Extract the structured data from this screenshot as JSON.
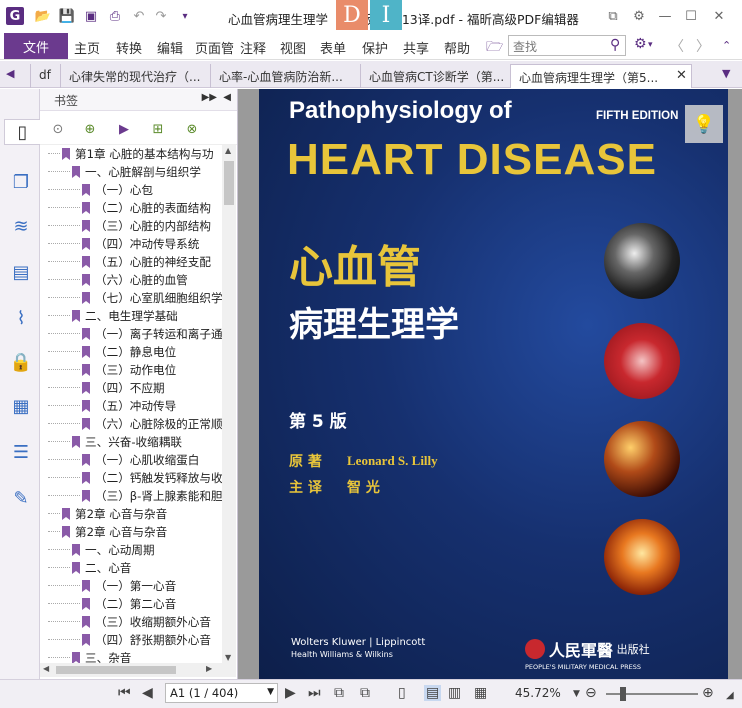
{
  "window": {
    "title": "心血管病理生理学（第5版）2013译.pdf - 福昕高级PDF编辑器",
    "badge1": "D",
    "badge2": "I"
  },
  "menu": {
    "file": "文件",
    "items": [
      "主页",
      "转换",
      "编辑",
      "页面管",
      "注释",
      "视图",
      "表单",
      "保护",
      "共享",
      "帮助"
    ],
    "search_placeholder": "查找"
  },
  "tabs": [
    {
      "label": "df"
    },
    {
      "label": "心律失常的现代治疗（..."
    },
    {
      "label": "心率-心血管病防治新..."
    },
    {
      "label": "心血管病CT诊断学（第..."
    },
    {
      "label": "心血管病理生理学（第5..."
    }
  ],
  "bookmarks": {
    "header": "书签",
    "items": [
      {
        "level": 0,
        "text": "第1章  心脏的基本结构与功"
      },
      {
        "level": 1,
        "text": "一、心脏解剖与组织学"
      },
      {
        "level": 2,
        "text": "（一）心包"
      },
      {
        "level": 2,
        "text": "（二）心脏的表面结构"
      },
      {
        "level": 2,
        "text": "（三）心脏的内部结构"
      },
      {
        "level": 2,
        "text": "（四）冲动传导系统"
      },
      {
        "level": 2,
        "text": "（五）心脏的神经支配"
      },
      {
        "level": 2,
        "text": "（六）心脏的血管"
      },
      {
        "level": 2,
        "text": "（七）心室肌细胞组织学"
      },
      {
        "level": 1,
        "text": "二、电生理学基础"
      },
      {
        "level": 2,
        "text": "（一）离子转运和离子通"
      },
      {
        "level": 2,
        "text": "（二）静息电位"
      },
      {
        "level": 2,
        "text": "（三）动作电位"
      },
      {
        "level": 2,
        "text": "（四）不应期"
      },
      {
        "level": 2,
        "text": "（五）冲动传导"
      },
      {
        "level": 2,
        "text": "（六）心脏除极的正常顺"
      },
      {
        "level": 1,
        "text": "三、兴奋-收缩耦联"
      },
      {
        "level": 2,
        "text": "（一）心肌收缩蛋白"
      },
      {
        "level": 2,
        "text": "（二）钙触发钙释放与收"
      },
      {
        "level": 2,
        "text": "（三）β-肾上腺素能和胆"
      },
      {
        "level": 0,
        "text": "第2章  心音与杂音"
      },
      {
        "level": 0,
        "text": "第2章  心音与杂音"
      },
      {
        "level": 1,
        "text": "一、心动周期"
      },
      {
        "level": 1,
        "text": "二、心音"
      },
      {
        "level": 2,
        "text": "（一）第一心音"
      },
      {
        "level": 2,
        "text": "（二）第二心音"
      },
      {
        "level": 2,
        "text": "（三）收缩期额外心音"
      },
      {
        "level": 2,
        "text": "（四）舒张期额外心音"
      },
      {
        "level": 1,
        "text": "三、杂音"
      }
    ]
  },
  "cover": {
    "title_en1": "Pathophysiology of",
    "title_en2": "HEART DISEASE",
    "edition_en": "FIFTH EDITION",
    "title_cn1": "心血管",
    "title_cn2": "病理生理学",
    "edition_cn": "第 5 版",
    "author_role": "原  著",
    "author_name": "Leonard S. Lilly",
    "translator_role": "主  译",
    "translator_name": "智  光",
    "publisher_left1": "Wolters Kluwer | Lippincott",
    "publisher_left2": "Health        Williams & Wilkins",
    "publisher_right_logo": "人民軍醫",
    "publisher_right_cn": "出版社",
    "publisher_right_en": "PEOPLE'S MILITARY MEDICAL PRESS"
  },
  "status": {
    "page": "A1 (1 / 404)",
    "zoom": "45.72%"
  },
  "colors": {
    "accent": "#6b3a8e",
    "cover_bg": "#16306f",
    "cover_gold": "#e8c53a"
  }
}
